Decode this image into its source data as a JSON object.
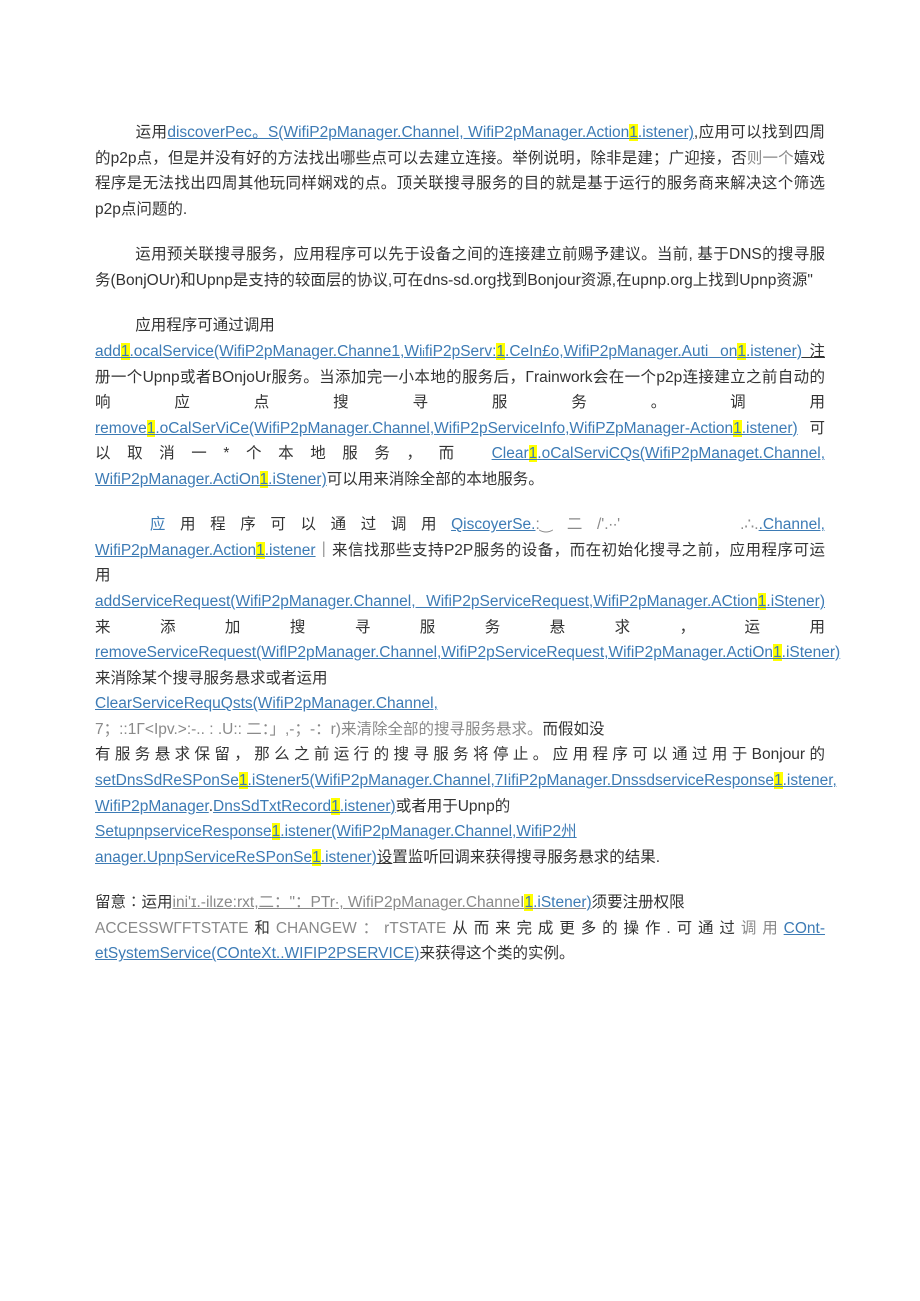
{
  "p1": {
    "t1": "运用",
    "t2": "discoverPec。S(WifiP2pManager.Channel, WifiP2pManager.Action",
    "t3": "1",
    "t4": ".istener)",
    "t5": ",应用可以找到四周的p2p点，但是并没有好的方法找出哪些点可以去建立连接。举例说明，除非是建；广迎接，否",
    "t6": "则一个",
    "t7": "嬉戏程序是无法找出四周其他玩同样娴戏的点。顶关联搜寻服务的目的就是基于运行的服务商来解决这个筛选p2p点问题的."
  },
  "p2": {
    "t1": "运用预关联搜寻服务，应用程序可以先于设备之间的连接建立前赐予建议。当前, 基于DNS的搜寻服务(BonjOUr)和Upnp是支持的较面层的协议,可在dns-sd.org找到Bonjour资源,在upnp.org上找到Upnp资源\""
  },
  "p3": {
    "t1": "应用程序可通过调用",
    "t2": "add",
    "t3": "1",
    "t4": ".ocalService(WifiP2pManager.Channe1,Wi",
    "t4b": "i",
    "t4c": "fiP2pServ:",
    "t5": "1",
    "t6": ".CeIn£o,WifiP2pManager.Auti on",
    "t7": "1",
    "t8": ".istener)",
    "t9": "注",
    "t10": "册一个Upnp或者BOnjoUr服务。当添加完一小本地的服务后，Γrainwork会在一个p2p连接建立之前自动的响应点搜寻服务。调用",
    "t11": "remove",
    "t12": "1",
    "t13": ".oCalSerViCe(WifiP2pManager.Channel,WifiP2pServiceInfo,WifiPZpManager-Action",
    "t14": "1",
    "t15": ".istener)",
    "t16": "可以取消一*个本地服务，而",
    "t17": "Clear",
    "t18": "1",
    "t19": ".oCalServiCQs(WifiP2pManaget.Channel, WifiP2pManager.ActiOn",
    "t20": "1",
    "t21": ".iStener)",
    "t22": "可以用来消除全部的本地服务。"
  },
  "p4": {
    "t1": "应",
    "t2": "用程序可以通过调用",
    "t3": "QiscoyerSe.",
    "t4": ":‿⼆/'.∙∙'",
    "t5": ".∴.",
    "t6": ".Channel, WifiP2pManager.Action",
    "t7": "1",
    "t8": ".istener",
    "t9": "｜来信找那些支持P2P服务的设备，而在初始化搜寻之前，应用程序可运用",
    "t10": "addServiceRequest(WifiP2pManager.Channel, WifiP2pServiceRequest,WifiP2pManager.ACtion",
    "t11": "1",
    "t12": ".iStener)",
    "t13": "来添加搜寻服务悬求，运用",
    "t14": "removeServiceRequest(WiflP2pManager.Channel,WifiP2pServiceRequest,WifiP2pManager.ActiOn",
    "t15": "1",
    "t16": ".iStener)",
    "t17": "来消除某个搜寻服务悬求或者运用",
    "t18": "ClearServiceRequQsts(WifiP2pManager.Channel,",
    "t19": "7；::1Γ<Ιpv.>:-.. :   .U:: 二：」,-；-：r)",
    "t20": "来清除全部的搜寻服务悬求。",
    "t21": "而假如没",
    "t22": "有服务悬求保留，那么之前运行的搜寻服务将停止。应用程序可以通过用于Bonjour的",
    "t23": "setDnsSdReSPonSe",
    "t24": "1",
    "t25": ".iStener5(WifiP2pManager.Channel,7IifiP2pManager.DnssdserviceResponse",
    "t26": "1",
    "t27": ".istener,",
    "t28": "WifiP2pManager",
    "t29": ".",
    "t30": "DnsSdTxtRecord",
    "t31": "1",
    "t32": ".istener)",
    "t33": "或者用于Upnp的",
    "t34": "SetupnpserviceResponse",
    "t35": "1",
    "t36": ".istener(WifiP2pManager.",
    "t37": "Channel",
    "t38": ",",
    "t39": "WifiP2州",
    "t40": "anager.UpnpServiceReSPonSe",
    "t41": "1",
    "t42": ".istener)",
    "t43": "设",
    "t44": "置监听回调来获得搜寻服务悬求的结果."
  },
  "p5": {
    "t1": "留意∶运用",
    "t2": "ini'ɪ.-ilιze:rxt,二：\"：PTr∙, WifiP2pManager.ChanneI",
    "t3": "1",
    "t4": ".iStener)",
    "t5": "须要注册权限",
    "t6": "ACCESSWΓFTSTATE",
    "t7": "和",
    "t8": "CHANGEW：rTSTATE",
    "t9": "从而来完成更多的操作.可通过",
    "t10": "调用",
    "t11": "COnt-etSystemService(COnteXt..WIFIP2PSERVICE)",
    "t12": "来获得这个类的实例。"
  }
}
